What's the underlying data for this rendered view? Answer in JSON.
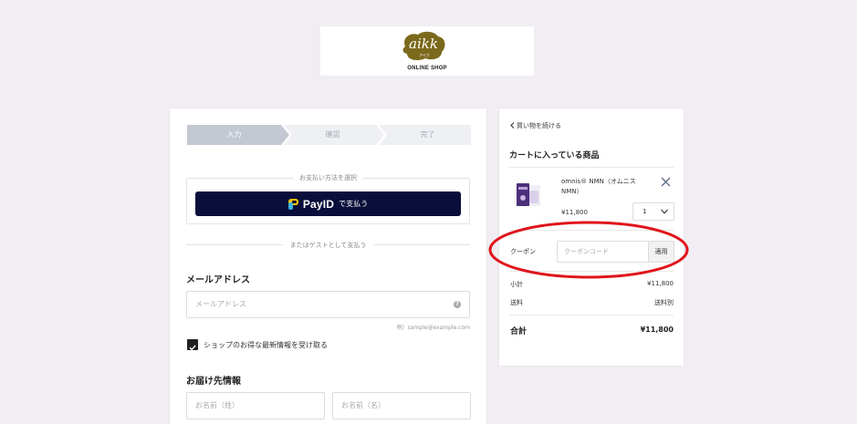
{
  "logo": {
    "wordmark": "aikk",
    "kana": "アイク",
    "subtitle": "ONLINE SHOP",
    "brand_color": "#7b6a1c"
  },
  "steps": [
    {
      "label": "入力",
      "state": "active"
    },
    {
      "label": "確認",
      "state": "inactive"
    },
    {
      "label": "完了",
      "state": "inactive"
    }
  ],
  "payment": {
    "legend": "お支払い方法を選択",
    "payid_word": "PayID",
    "payid_suffix": "で支払う",
    "button_color": "#0a0e3a"
  },
  "guest": {
    "label": "またはゲストとして支払う"
  },
  "email": {
    "title": "メールアドレス",
    "placeholder": "メールアドレス",
    "example": "例）sample@example.com",
    "help_icon": "question-circle-icon"
  },
  "newsletter": {
    "label": "ショップのお得な最新情報を受け取る",
    "checked": true
  },
  "shipping": {
    "title": "お届け先情報",
    "last_name_placeholder": "お名前（姓）",
    "first_name_placeholder": "お名前（名）"
  },
  "cart": {
    "continue_label": "買い物を続ける",
    "title": "カートに入っている商品",
    "item": {
      "name": "omnis® NMN（オムニスNMN）",
      "price": "¥11,800",
      "quantity": "1"
    },
    "coupon": {
      "label": "クーポン",
      "placeholder": "クーポンコード",
      "apply_label": "適用",
      "highlight_color": "#e0141b"
    },
    "subtotal_label": "小計",
    "subtotal_value": "¥11,800",
    "shipping_label": "送料",
    "shipping_value": "送料別",
    "total_label": "合計",
    "total_value": "¥11,800"
  }
}
